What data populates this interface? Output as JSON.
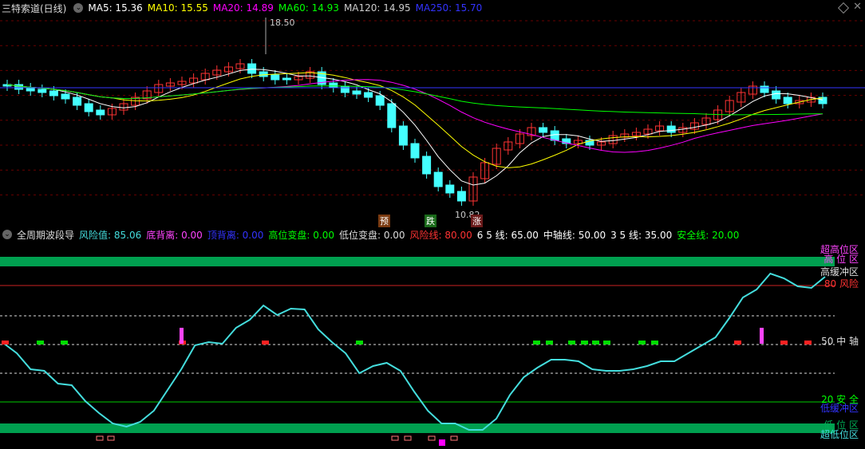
{
  "top": {
    "title": "三特索道(日线)",
    "ma": [
      {
        "label": "MA5: 15.36",
        "color": "#ffffff"
      },
      {
        "label": "MA10: 15.55",
        "color": "#ffff00"
      },
      {
        "label": "MA20: 14.89",
        "color": "#ff00ff"
      },
      {
        "label": "MA60: 14.93",
        "color": "#00ff00"
      },
      {
        "label": "MA120: 14.95",
        "color": "#cccccc"
      },
      {
        "label": "MA250: 15.70",
        "color": "#3333ff"
      }
    ],
    "high_label": "18.50",
    "low_label": "10.82",
    "badge_pre": "预",
    "badge_die": "跌",
    "badge_zhang": "涨"
  },
  "bottom": {
    "title": "全周期波段导",
    "values": [
      {
        "label": "风险值: 85.06",
        "color": "#44dddd"
      },
      {
        "label": "底背离: 0.00",
        "color": "#ff44ff"
      },
      {
        "label": "顶背离: 0.00",
        "color": "#3333ff"
      },
      {
        "label": "高位变盘: 0.00",
        "color": "#00ff00"
      },
      {
        "label": "低位变盘: 0.00",
        "color": "#dddddd"
      },
      {
        "label": "风险线: 80.00",
        "color": "#ff3333"
      },
      {
        "label": "6 5 线: 65.00",
        "color": "#ffffff"
      },
      {
        "label": "中轴线: 50.00",
        "color": "#ffffff"
      },
      {
        "label": "3 5 线: 35.00",
        "color": "#ffffff"
      },
      {
        "label": "安全线: 20.00",
        "color": "#00ff00"
      }
    ],
    "right_labels": {
      "super_high": "超高位区",
      "high": "高 位 区",
      "high_buffer": "高缓冲区",
      "risk": "80 风险",
      "mid": "50 中 轴",
      "safe": "20 安 全",
      "low_buffer": "低缓冲区",
      "low": "低 位 区",
      "super_low": "超低位区"
    }
  },
  "colors": {
    "up": "#ff3333",
    "down": "#44ffff",
    "osc": "#44dddd",
    "band": "#00a050"
  }
}
